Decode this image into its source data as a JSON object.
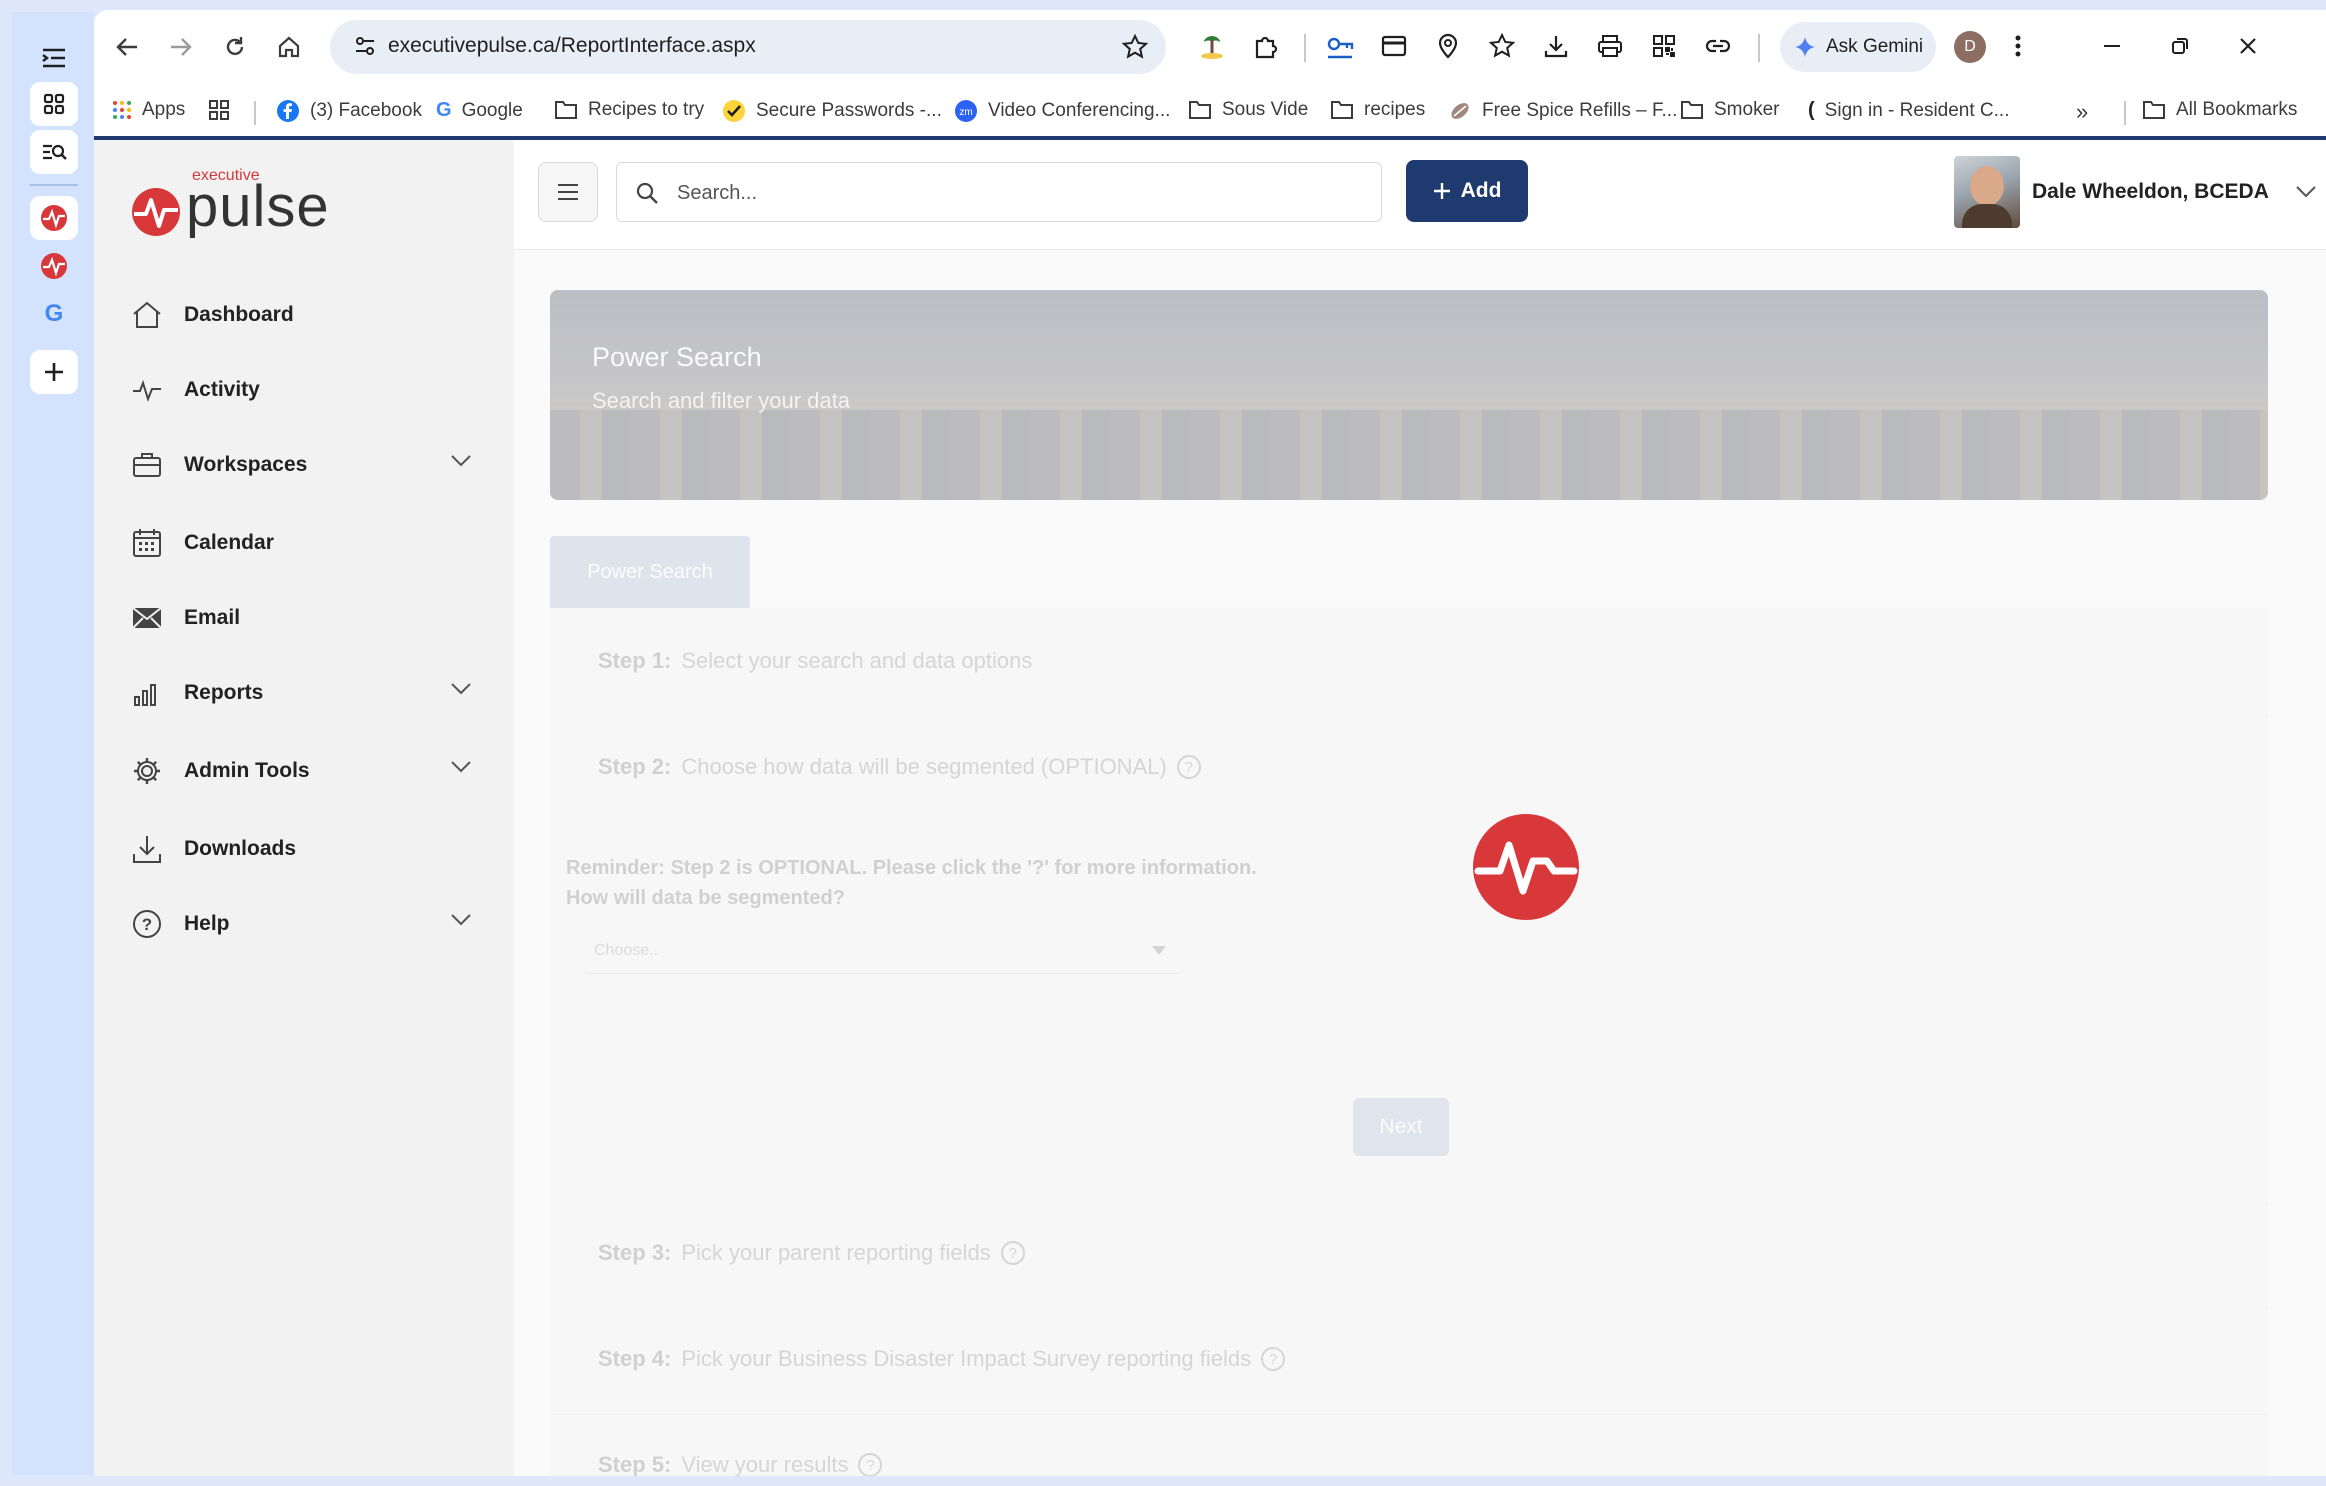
{
  "browser": {
    "url": "executivepulse.ca/ReportInterface.aspx",
    "gemini_label": "Ask Gemini",
    "profile_initial": "D",
    "bookmarks": [
      {
        "label": "Apps",
        "icon": "apps-grid-icon"
      },
      {
        "label": "",
        "icon": "tab-groups-icon"
      },
      {
        "label": "(3) Facebook",
        "icon": "facebook-icon"
      },
      {
        "label": "Google",
        "icon": "google-icon"
      },
      {
        "label": "Recipes to try",
        "icon": "folder-icon"
      },
      {
        "label": "Secure Passwords -...",
        "icon": "checkmark-icon"
      },
      {
        "label": "Video Conferencing...",
        "icon": "zoom-icon"
      },
      {
        "label": "Sous Vide",
        "icon": "folder-icon"
      },
      {
        "label": "recipes",
        "icon": "folder-icon"
      },
      {
        "label": "Free Spice Refills – F...",
        "icon": "spice-icon"
      },
      {
        "label": "Smoker",
        "icon": "folder-icon"
      },
      {
        "label": "Sign in - Resident C...",
        "icon": "site-icon"
      },
      {
        "label": "All Bookmarks",
        "icon": "folder-icon"
      }
    ],
    "overflow_label": "»"
  },
  "app": {
    "logo": {
      "small_text": "executive",
      "big_text": "pulse"
    },
    "nav": [
      {
        "label": "Dashboard",
        "icon": "home-icon",
        "expandable": false
      },
      {
        "label": "Activity",
        "icon": "activity-icon",
        "expandable": false
      },
      {
        "label": "Workspaces",
        "icon": "briefcase-icon",
        "expandable": true
      },
      {
        "label": "Calendar",
        "icon": "calendar-icon",
        "expandable": false
      },
      {
        "label": "Email",
        "icon": "envelope-icon",
        "expandable": false
      },
      {
        "label": "Reports",
        "icon": "bar-chart-icon",
        "expandable": true
      },
      {
        "label": "Admin Tools",
        "icon": "gear-icon",
        "expandable": true
      },
      {
        "label": "Downloads",
        "icon": "download-icon",
        "expandable": false
      },
      {
        "label": "Help",
        "icon": "help-circle-icon",
        "expandable": true
      }
    ],
    "search_placeholder": "Search...",
    "add_label": "Add",
    "user_name": "Dale Wheeldon, BCEDA"
  },
  "page": {
    "banner_title": "Power Search",
    "banner_subtitle": "Search and filter your data",
    "tab_label": "Power Search",
    "steps": [
      {
        "num": "Step 1:",
        "text": "Select your search and data options",
        "help": false
      },
      {
        "num": "Step 2:",
        "text": "Choose how data will be segmented (OPTIONAL)",
        "help": true
      },
      {
        "num": "Step 3:",
        "text": "Pick your parent reporting fields",
        "help": true
      },
      {
        "num": "Step 4:",
        "text": "Pick your Business Disaster Impact Survey reporting fields",
        "help": true
      },
      {
        "num": "Step 5:",
        "text": "View your results",
        "help": true
      }
    ],
    "reminder_line1": "Reminder: Step 2 is OPTIONAL. Please click the '?' for more information.",
    "reminder_line2": "How will data be segmented?",
    "select_placeholder": "Choose..",
    "next_label": "Next",
    "help_symbol": "?"
  },
  "colors": {
    "brand_red": "#d9383a",
    "brand_navy": "#1e3a6e",
    "chrome_blue": "#d3e3fd"
  }
}
